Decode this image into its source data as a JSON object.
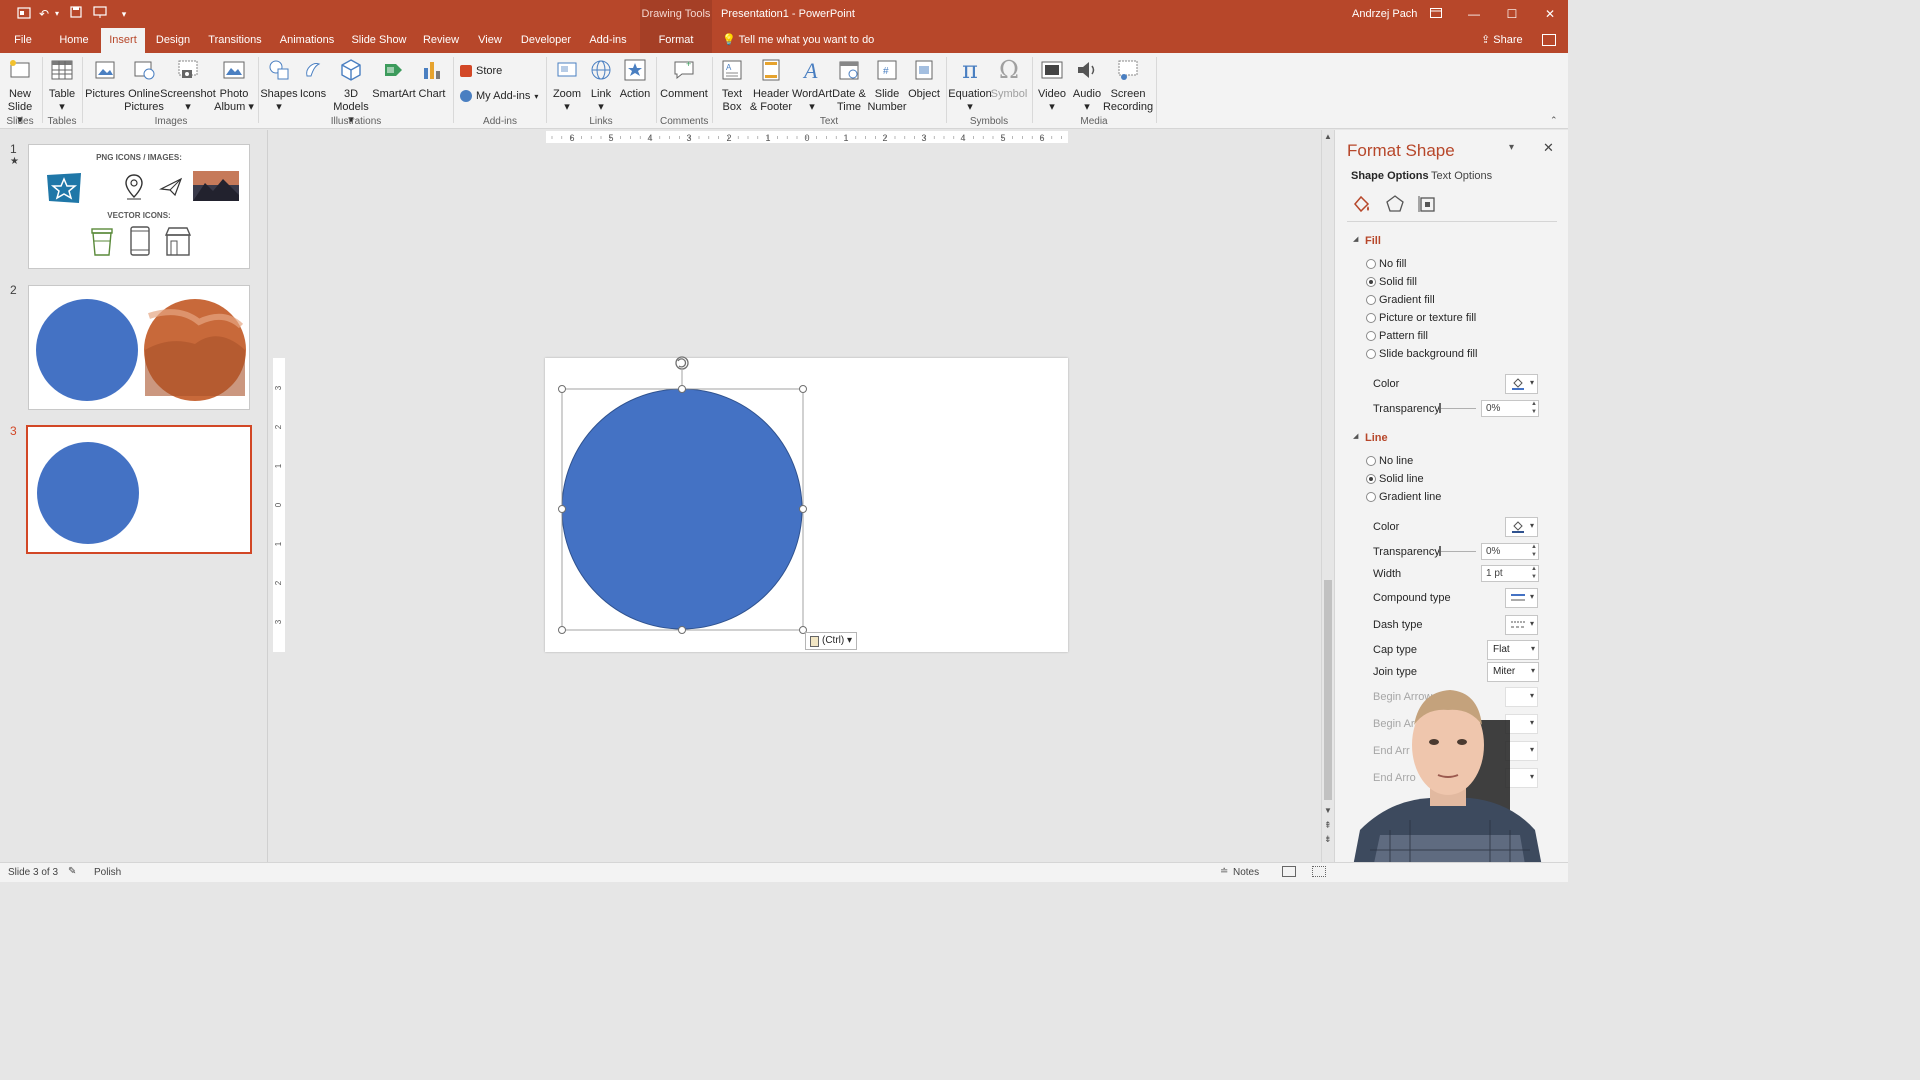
{
  "title_bar": {
    "context_tab": "Drawing Tools",
    "document_title": "Presentation1  -  PowerPoint",
    "user": "Andrzej Pach"
  },
  "tabs": [
    "File",
    "Home",
    "Insert",
    "Design",
    "Transitions",
    "Animations",
    "Slide Show",
    "Review",
    "View",
    "Developer",
    "Add-ins",
    "Format"
  ],
  "active_tab": "Insert",
  "tell_me": "Tell me what you want to do",
  "share": "Share",
  "ribbon": {
    "slides": {
      "new_slide": "New\nSlide ▾",
      "group": "Slides"
    },
    "tables": {
      "table": "Table\n▾",
      "group": "Tables"
    },
    "images": {
      "pictures": "Pictures",
      "online_pictures": "Online\nPictures",
      "screenshot": "Screenshot\n▾",
      "photo_album": "Photo\nAlbum ▾",
      "group": "Images"
    },
    "illustrations": {
      "shapes": "Shapes\n▾",
      "icons": "Icons",
      "models": "3D\nModels ▾",
      "smartart": "SmartArt",
      "chart": "Chart",
      "group": "Illustrations"
    },
    "addins": {
      "store": "Store",
      "my_addins": "My Add-ins",
      "group": "Add-ins"
    },
    "links": {
      "zoom": "Zoom\n▾",
      "link": "Link\n▾",
      "action": "Action",
      "group": "Links"
    },
    "comments": {
      "comment": "Comment",
      "group": "Comments"
    },
    "text": {
      "text_box": "Text\nBox",
      "header_footer": "Header\n& Footer",
      "wordart": "WordArt\n▾",
      "date_time": "Date &\nTime",
      "slide_number": "Slide\nNumber",
      "object": "Object",
      "group": "Text"
    },
    "symbols": {
      "equation": "Equation\n▾",
      "symbol": "Symbol",
      "group": "Symbols"
    },
    "media": {
      "video": "Video\n▾",
      "audio": "Audio\n▾",
      "screen_recording": "Screen\nRecording",
      "group": "Media"
    }
  },
  "slides": [
    {
      "number": "1",
      "png_heading": "PNG ICONS / IMAGES:",
      "vector_heading": "VECTOR ICONS:"
    },
    {
      "number": "2"
    },
    {
      "number": "3"
    }
  ],
  "paste_tag": "(Ctrl) ▾",
  "format_pane": {
    "title": "Format Shape",
    "tab_shape": "Shape Options",
    "tab_text": "Text Options",
    "fill": {
      "title": "Fill",
      "options": [
        "No fill",
        "Solid fill",
        "Gradient fill",
        "Picture or texture fill",
        "Pattern fill",
        "Slide background fill"
      ],
      "selected_index": 1,
      "color_label": "Color",
      "transparency_label": "Transparency",
      "transparency_value": "0%"
    },
    "line": {
      "title": "Line",
      "options": [
        "No line",
        "Solid line",
        "Gradient line"
      ],
      "selected_index": 1,
      "color_label": "Color",
      "transparency_label": "Transparency",
      "transparency_value": "0%",
      "width_label": "Width",
      "width_value": "1 pt",
      "compound_label": "Compound type",
      "dash_label": "Dash type",
      "cap_label": "Cap type",
      "cap_value": "Flat",
      "join_label": "Join type",
      "join_value": "Miter",
      "begin_arrow_type": "Begin Arrow",
      "begin_arrow_size": "Begin Ar",
      "end_arrow_type": "End Arr",
      "end_arrow_size": "End Arro"
    }
  },
  "status": {
    "slide": "Slide 3 of 3",
    "language": "Polish",
    "notes": "Notes"
  },
  "colors": {
    "accent": "#b7472a",
    "shape_fill": "#4472c4",
    "selection": "#d24726"
  }
}
